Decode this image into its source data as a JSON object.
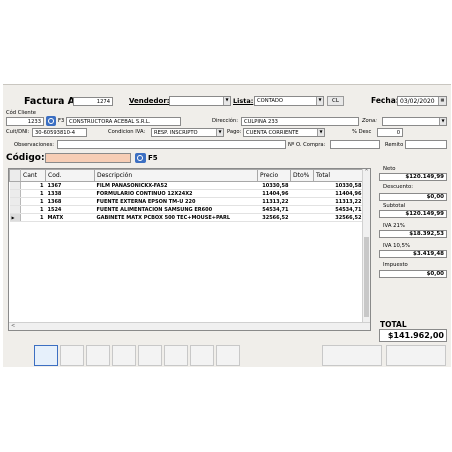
{
  "header": {
    "title": "Factura A",
    "number": "1274",
    "vendedor_label": "Vendedor:",
    "vendedor_value": "",
    "lista_label": "Lista:",
    "lista_value": "CONTADO",
    "cl_button": "CL",
    "fecha_label": "Fecha:",
    "fecha_value": "03/02/2020"
  },
  "client": {
    "cod_label": "Cód Cliente",
    "cod_value": "1233",
    "f3_label": "F3",
    "name": "CONSTRUCTORA ACEBAL S.R.L.",
    "direccion_label": "Dirección:",
    "direccion_value": "CULPINA 233",
    "zona_label": "Zona:",
    "zona_value": "",
    "cuit_label": "Cuit/DNI:",
    "cuit_value": "30-60593810-4",
    "iva_label": "Condicion IVA:",
    "iva_value": "RESP. INSCRIPTO",
    "pago_label": "Pago:",
    "pago_value": "CUENTA CORRIENTE",
    "desc_label": "% Desc",
    "desc_value": "0",
    "obs_label": "Observaciones:",
    "obs_value": "",
    "ocompra_label": "Nº O. Compra:",
    "ocompra_value": "",
    "remito_label": "Remito",
    "remito_value": ""
  },
  "code": {
    "label": "Código:",
    "value": "",
    "f5_label": "F5"
  },
  "table": {
    "headers": [
      "Cant",
      "Cod.",
      "Descripción",
      "Precio",
      "Dto%",
      "Total"
    ],
    "rows": [
      {
        "cant": "1",
        "cod": "1367",
        "desc": "FILM PANASONICKX-FA52",
        "precio": "10330,58",
        "dto": "",
        "total": "10330,58"
      },
      {
        "cant": "1",
        "cod": "1338",
        "desc": "FORMULARIO CONTINUO 12X24X2",
        "precio": "11404,96",
        "dto": "",
        "total": "11404,96"
      },
      {
        "cant": "1",
        "cod": "1368",
        "desc": "FUENTE EXTERNA EPSON TM-U 220",
        "precio": "11313,22",
        "dto": "",
        "total": "11313,22"
      },
      {
        "cant": "1",
        "cod": "1524",
        "desc": "FUENTE ALIMENTACION SAMSUNG ER600",
        "precio": "54534,71",
        "dto": "",
        "total": "54534,71"
      },
      {
        "cant": "1",
        "cod": "MATX",
        "desc": "GABINETE MATX PCBOX 500 TEC+MOUSE+PARL",
        "precio": "32566,52",
        "dto": "",
        "total": "32566,52"
      }
    ]
  },
  "summary": {
    "neto_label": "Neto",
    "neto_value": "$120.149,99",
    "descuento_label": "Descuento:",
    "descuento_value": "$0,00",
    "subtotal_label": "Subtotal",
    "subtotal_value": "$120.149,99",
    "iva21_label": "IVA 21%",
    "iva21_value": "$18.392,53",
    "iva105_label": "IVA 10,5%",
    "iva105_value": "$3.419,48",
    "impuesto_label": "Impuesto",
    "impuesto_value": "$0,00",
    "total_label": "TOTAL",
    "total_value": "$141.962,00"
  },
  "colors": {
    "window_bg": "#f0eeea",
    "code_field_bg": "#f6cdb5"
  },
  "icons": [
    "client-search-icon",
    "calendar-icon",
    "product-search-icon",
    "combo-arrow-icon",
    "row-indicator-icon"
  ]
}
